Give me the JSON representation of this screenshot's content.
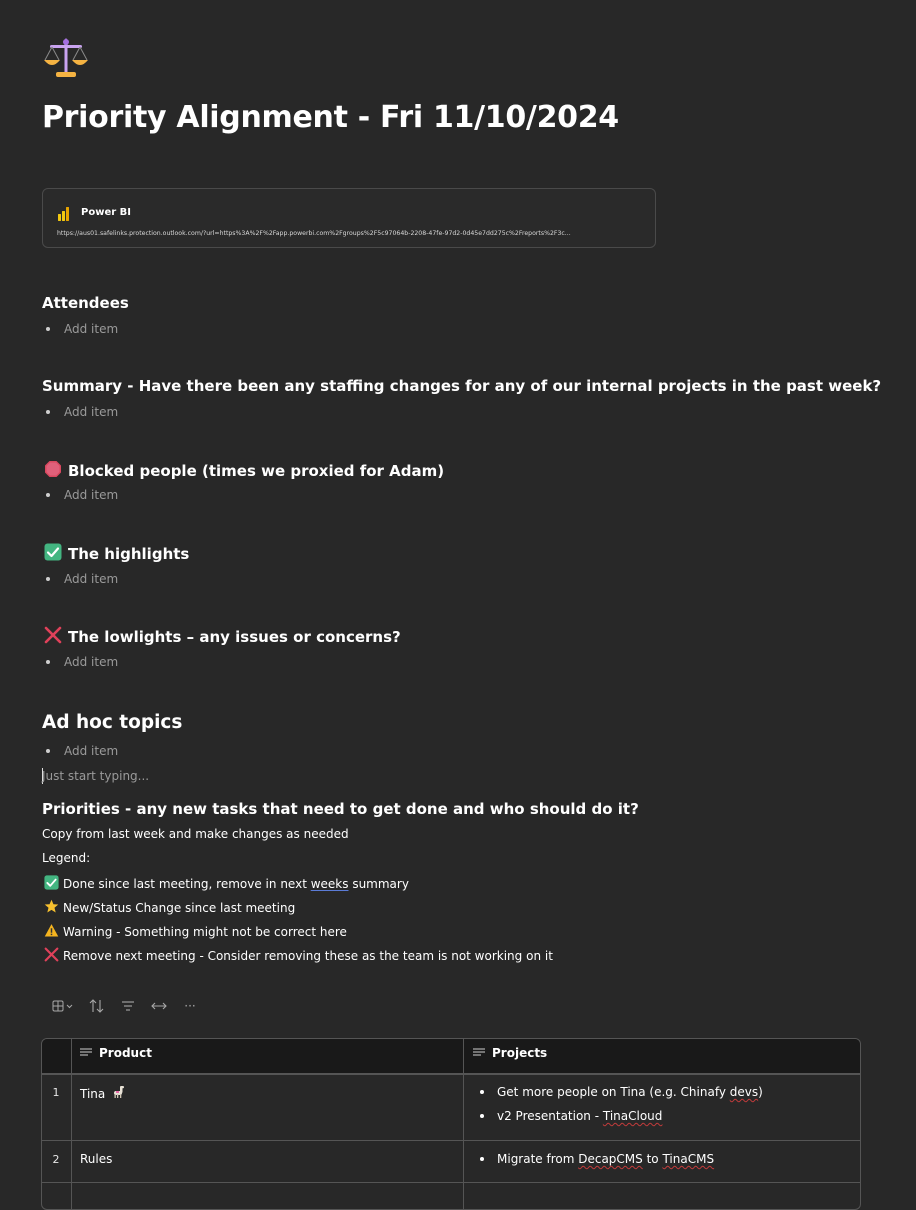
{
  "page": {
    "icon": "balance-scale-icon",
    "title": "Priority Alignment - Fri 11/10/2024"
  },
  "link_card": {
    "app_name": "Power BI",
    "url": "https://aus01.safelinks.protection.outlook.com/?url=https%3A%2F%2Fapp.powerbi.com%2Fgroups%2F5c97064b-2208-47fe-97d2-0d45e7dd275c%2Freports%2F3c..."
  },
  "sections": [
    {
      "icon": "",
      "heading": "Attendees",
      "item_placeholder": "Add item"
    },
    {
      "icon": "",
      "heading": "Summary - Have there been any staffing changes for any of our internal projects in the past week?",
      "item_placeholder": "Add item"
    },
    {
      "icon": "stop-sign-icon",
      "heading": "Blocked people (times we proxied for Adam)",
      "item_placeholder": "Add item"
    },
    {
      "icon": "check-mark-icon",
      "heading": "The highlights",
      "item_placeholder": "Add item"
    },
    {
      "icon": "cross-mark-icon",
      "heading": "The lowlights – any issues or concerns?",
      "item_placeholder": "Add item"
    }
  ],
  "adhoc": {
    "heading": "Ad hoc topics",
    "item_placeholder": "Add item",
    "typing_placeholder": "Just start typing..."
  },
  "priorities": {
    "heading": "Priorities - any new tasks that need to get done and who should do it?",
    "note": "Copy from last week and make changes as needed",
    "legend_label": "Legend:",
    "legend": [
      {
        "icon": "check-mark-icon",
        "text_a": "Done since last meeting, remove in next ",
        "text_b": "weeks",
        "text_c": " summary"
      },
      {
        "icon": "star-icon",
        "text": "New/Status Change since last meeting"
      },
      {
        "icon": "warning-icon",
        "text": "Warning - Something might not be correct here"
      },
      {
        "icon": "cross-mark-icon",
        "text": "Remove next meeting - Consider removing these as the team is not working on it"
      }
    ]
  },
  "toolbar": {
    "items": [
      "table-view-icon",
      "sort-icon",
      "filter-icon",
      "column-width-icon",
      "more-icon"
    ],
    "more_label": "···"
  },
  "table": {
    "columns": [
      "Product",
      "Projects"
    ],
    "rows": [
      {
        "num": "1",
        "product": "Tina",
        "product_icon": "llama-icon",
        "projects": [
          {
            "a": "Get more people on Tina (e.g. Chinafy ",
            "b": "devs",
            "c": ")"
          },
          {
            "a": "v2 Presentation - ",
            "b": "TinaCloud",
            "c": ""
          }
        ]
      },
      {
        "num": "2",
        "product": "Rules",
        "product_icon": "",
        "projects": [
          {
            "a": "Migrate from ",
            "b": "DecapCMS",
            "c": " to ",
            "d": "TinaCMS"
          }
        ]
      }
    ]
  },
  "colors": {
    "background": "#282828",
    "header_row": "#191919",
    "border": "#555555",
    "muted_text": "#9a9a9a",
    "spell_underline": "#c23b3b"
  }
}
